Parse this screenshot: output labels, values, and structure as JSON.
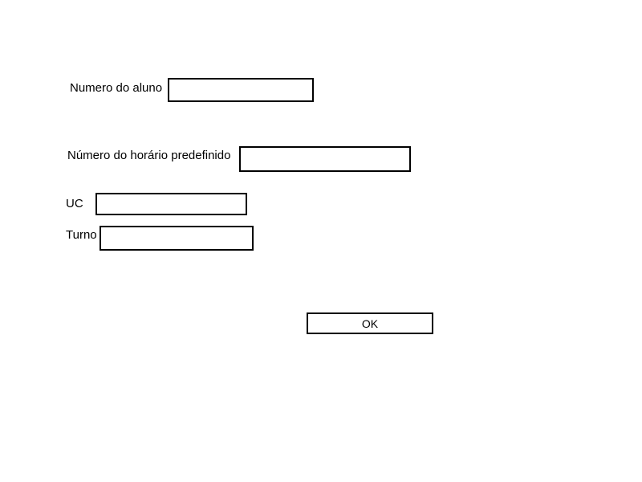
{
  "form": {
    "student_number": {
      "label": "Numero do aluno",
      "value": ""
    },
    "schedule_number": {
      "label": "Número do horário predefinido",
      "value": ""
    },
    "uc": {
      "label": "UC",
      "value": ""
    },
    "shift": {
      "label": "Turno",
      "value": ""
    },
    "ok_label": "OK"
  }
}
